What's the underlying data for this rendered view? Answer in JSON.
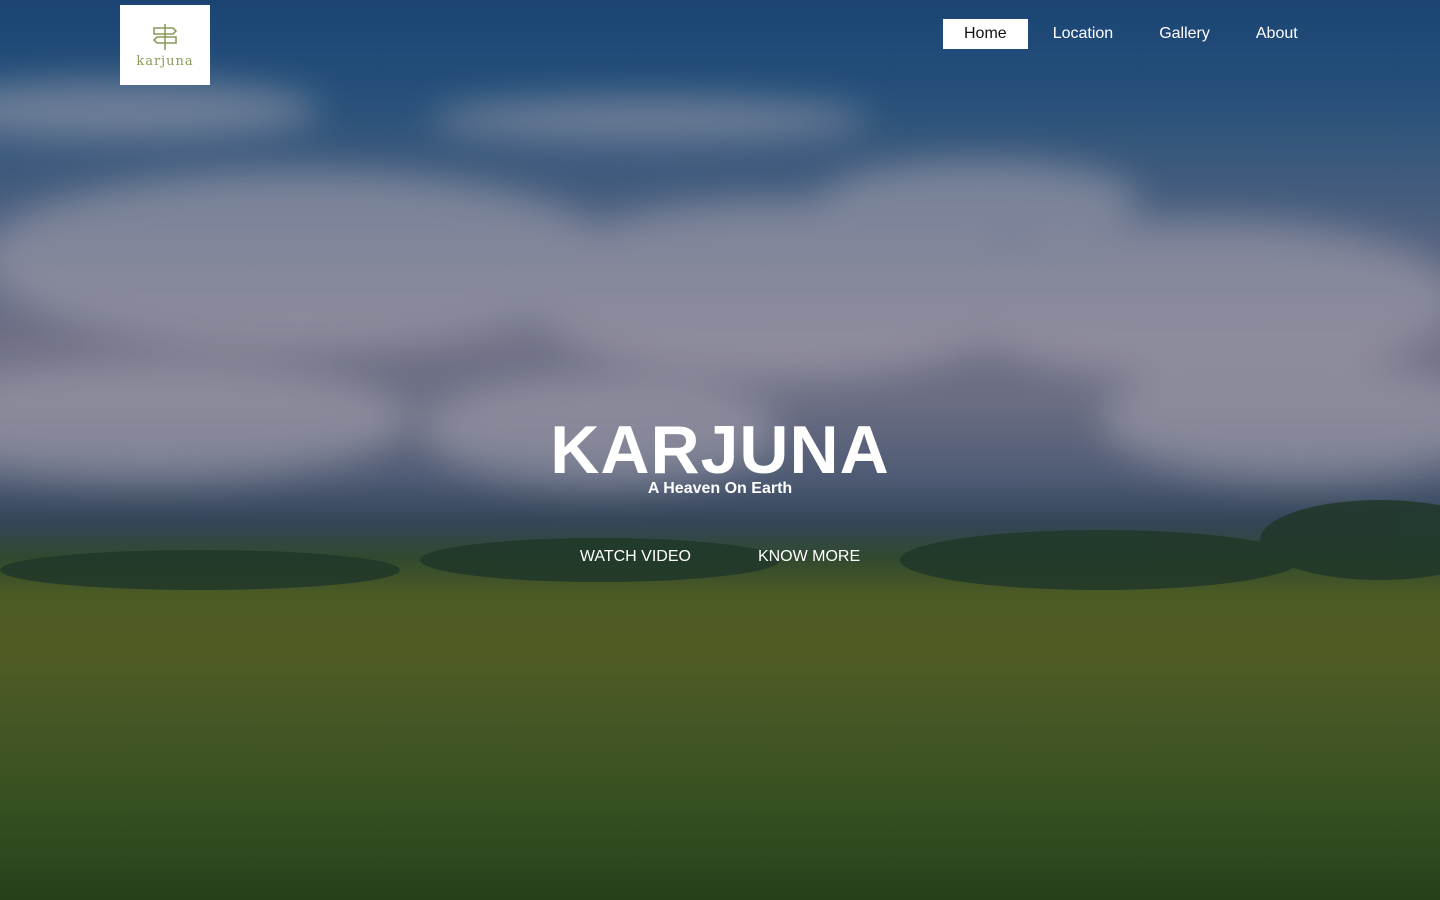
{
  "brand": {
    "logo_text": "karjuna",
    "logo_icon": "signpost-icon"
  },
  "nav": {
    "items": [
      {
        "label": "Home",
        "active": true
      },
      {
        "label": "Location",
        "active": false
      },
      {
        "label": "Gallery",
        "active": false
      },
      {
        "label": "About",
        "active": false
      }
    ]
  },
  "hero": {
    "title": "KARJUNA",
    "subtitle": "A Heaven On Earth",
    "buttons": {
      "watch_video": "WATCH VIDEO",
      "know_more": "KNOW MORE"
    }
  },
  "colors": {
    "sky": "#2b5c8c",
    "field": "#5f6a22",
    "logo_accent": "#8a9a5b",
    "text": "#ffffff"
  }
}
